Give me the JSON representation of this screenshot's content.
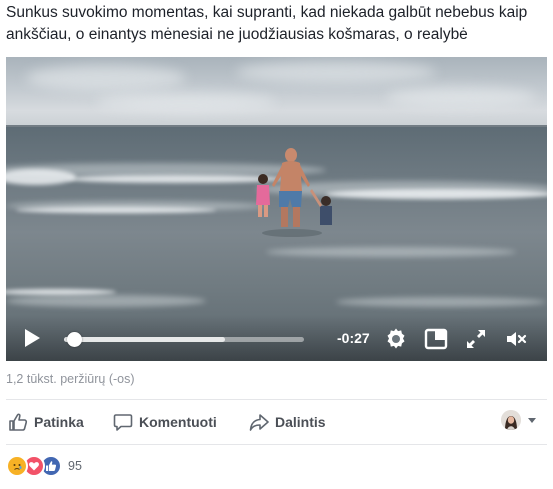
{
  "post": {
    "text": "Sunkus suvokimo momentas, kai supranti, kad niekada galbūt nebebus kaip ankščiau, o einantys mėnesiai ne juodžiausias košmaras, o realybė"
  },
  "video": {
    "time_remaining": "-0:27",
    "progress_fraction": 0.04,
    "buffered_fraction": 0.67
  },
  "stats": {
    "views": "1,2 tūkst. peržiūrų (-os)"
  },
  "actions": {
    "like": "Patinka",
    "comment": "Komentuoti",
    "share": "Dalintis"
  },
  "reactions": {
    "count": "95",
    "types": [
      "sad-icon",
      "love-icon",
      "like-icon"
    ]
  },
  "colors": {
    "facebook_blue": "#4267b2",
    "love_red": "#f25268",
    "sad_yellow": "#f7b125"
  }
}
